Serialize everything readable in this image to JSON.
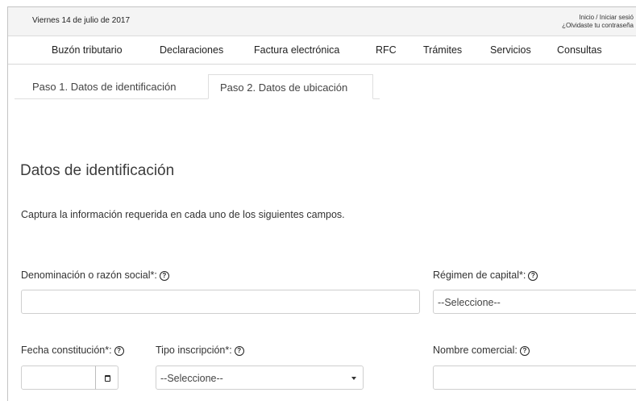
{
  "header": {
    "date": "Viernes 14 de julio de 2017",
    "login_link": "Inicio / Iniciar sesió",
    "forgot_password_link": "¿Olvidaste tu contraseña"
  },
  "nav": {
    "items": [
      "Buzón tributario",
      "Declaraciones",
      "Factura electrónica",
      "RFC",
      "Trámites",
      "Servicios",
      "Consultas"
    ]
  },
  "tabs": [
    {
      "label": "Paso 1. Datos de identificación",
      "active": false
    },
    {
      "label": "Paso 2. Datos de ubicación",
      "active": true
    }
  ],
  "form": {
    "section_title": "Datos de identificación",
    "instructions": "Captura la información requerida en cada uno de los siguientes campos.",
    "help_glyph": "?",
    "fields": {
      "razon_social": {
        "label": "Denominación o razón social*:",
        "value": ""
      },
      "regimen_capital": {
        "label": "Régimen de capital*:",
        "selected": "--Seleccione--"
      },
      "fecha_constitucion": {
        "label": "Fecha constitución*:",
        "value": ""
      },
      "tipo_inscripcion": {
        "label": "Tipo inscripción*:",
        "selected": "--Seleccione--"
      },
      "nombre_comercial": {
        "label": "Nombre comercial:",
        "value": ""
      }
    }
  },
  "colors": {
    "topbar_bg": "#f4f4f4",
    "border": "#cfcfcf",
    "text": "#333333"
  }
}
